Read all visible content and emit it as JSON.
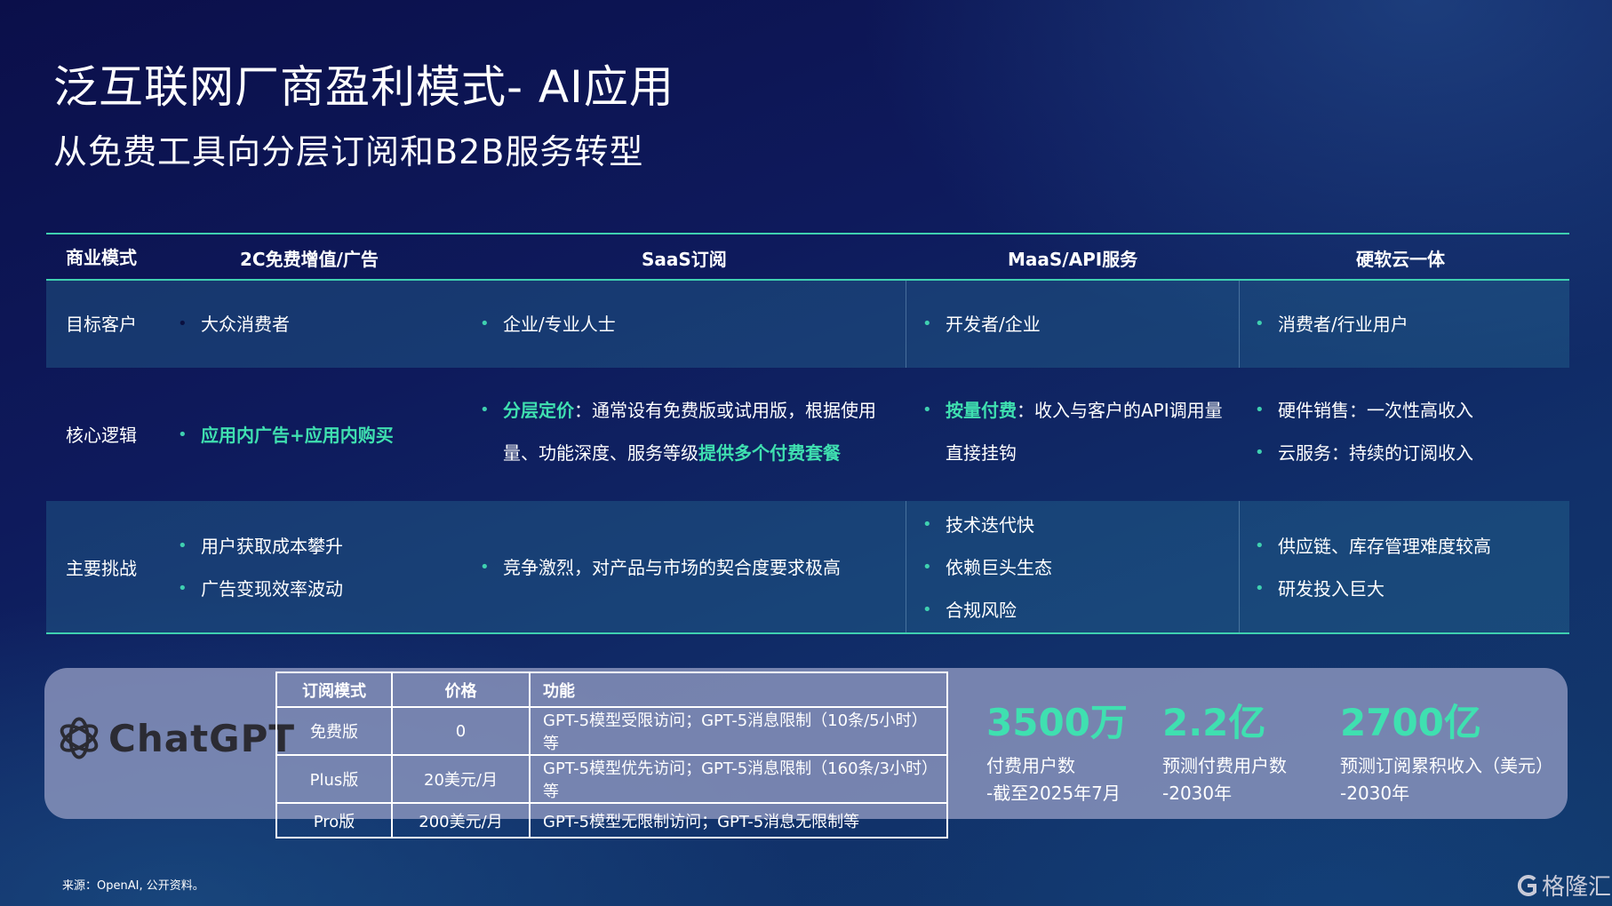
{
  "title": "泛互联网厂商盈利模式- AI应用",
  "subtitle": "从免费工具向分层订阅和B2B服务转型",
  "table": {
    "header": {
      "label": "商业模式",
      "c1": "2C免费增值/广告",
      "c2": "SaaS订阅",
      "c3": "MaaS/API服务",
      "c4": "硬软云一体"
    },
    "target": {
      "label": "目标客户",
      "c1": "大众消费者",
      "c2": "企业/专业人士",
      "c3": "开发者/企业",
      "c4": "消费者/行业用户"
    },
    "logic": {
      "label": "核心逻辑",
      "c1": "应用内广告+应用内购买",
      "c2_hl": "分层定价",
      "c2_text": "：通常设有免费版或试用版，根据使用量、功能深度、服务等级",
      "c2_hl2": "提供多个付费套餐",
      "c3_hl": "按量付费",
      "c3_text": "：收入与客户的API调用量直接挂钩",
      "c4_1": "硬件销售：一次性高收入",
      "c4_2": "云服务：持续的订阅收入"
    },
    "challenge": {
      "label": "主要挑战",
      "c1_1": "用户获取成本攀升",
      "c1_2": "广告变现效率波动",
      "c2": "竞争激烈，对产品与市场的契合度要求极高",
      "c3_1": "技术迭代快",
      "c3_2": "依赖巨头生态",
      "c3_3": "合规风险",
      "c4_1": "供应链、库存管理难度较高",
      "c4_2": "研发投入巨大"
    }
  },
  "chatgpt": {
    "logo_text": "ChatGPT",
    "headers": [
      "订阅模式",
      "价格",
      "功能"
    ],
    "rows": [
      [
        "免费版",
        "0",
        "GPT-5模型受限访问；GPT-5消息限制（10条/5小时）等"
      ],
      [
        "Plus版",
        "20美元/月",
        "GPT-5模型优先访问；GPT-5消息限制（160条/3小时）等"
      ],
      [
        "Pro版",
        "200美元/月",
        "GPT-5模型无限制访问；GPT-5消息无限制等"
      ]
    ],
    "stats": [
      {
        "num": "3500万",
        "l1": "付费用户数",
        "l2": "-截至2025年7月"
      },
      {
        "num": "2.2亿",
        "l1": "预测付费用户数",
        "l2": "-2030年"
      },
      {
        "num": "2700亿",
        "l1": "预测订阅累积收入（美元）",
        "l2": "-2030年"
      }
    ]
  },
  "source": "来源：OpenAI, 公开资料。",
  "brand": "格隆汇",
  "colors": {
    "accent": "#3fe0b0",
    "line": "#3fd0b0",
    "panel": "#8c96be"
  }
}
